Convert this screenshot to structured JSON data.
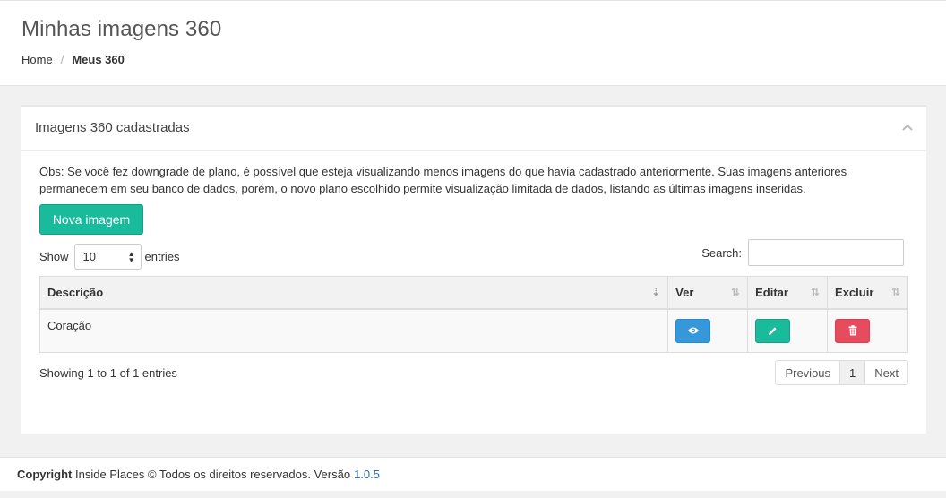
{
  "header": {
    "title": "Minhas imagens 360",
    "breadcrumb": {
      "home": "Home",
      "separator": "/",
      "current": "Meus 360"
    }
  },
  "panel": {
    "title": "Imagens 360 cadastradas",
    "notice": "Obs: Se você fez downgrade de plano, é possível que esteja visualizando menos imagens do que havia cadastrado anteriormente. Suas imagens anteriores permanecem em seu banco de dados, porém, o novo plano escolhido permite visualização limitada de dados, listando as últimas imagens inseridas.",
    "new_button": "Nova imagem",
    "show_label": "Show",
    "show_value": "10",
    "entries_label": "entries",
    "search_label": "Search:",
    "search_value": "",
    "table": {
      "columns": [
        "Descrição",
        "Ver",
        "Editar",
        "Excluir"
      ],
      "rows": [
        {
          "descricao": "Coração"
        }
      ]
    },
    "info": "Showing 1 to 1 of 1 entries",
    "pagination": {
      "previous": "Previous",
      "current": "1",
      "next": "Next"
    }
  },
  "footer": {
    "copyright_label": "Copyright",
    "text": "Inside Places © Todos os direitos reservados. Versão",
    "version": "1.0.5"
  },
  "colors": {
    "accent_green": "#1abb9c",
    "view_blue": "#3498db",
    "delete_red": "#e74c5e"
  }
}
